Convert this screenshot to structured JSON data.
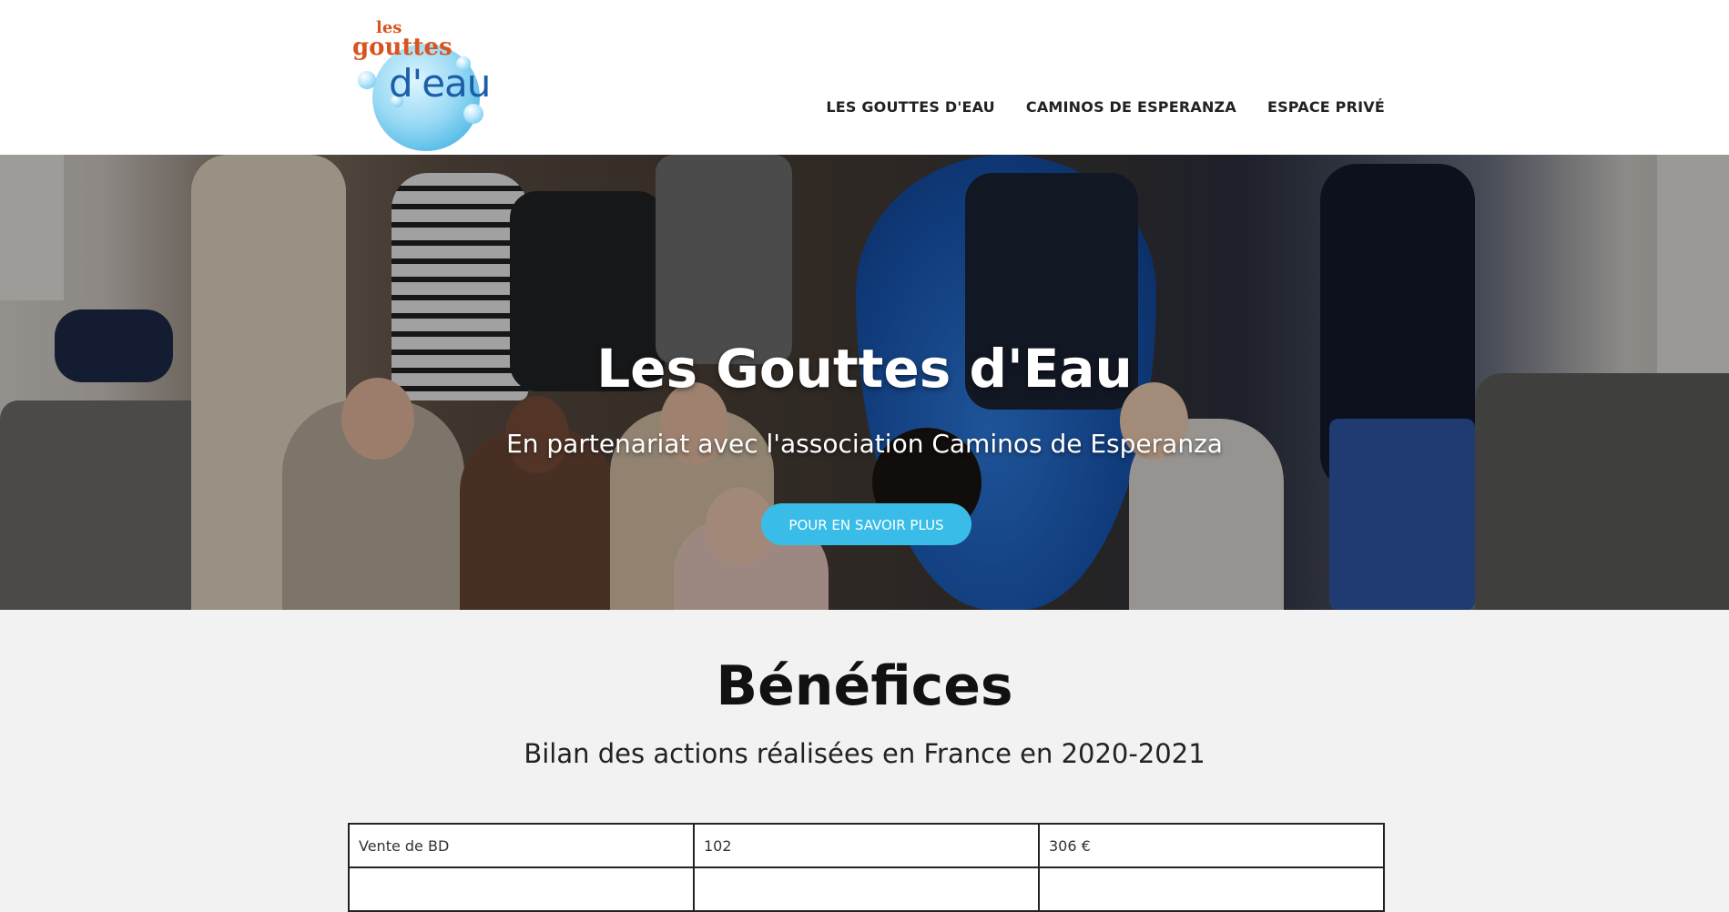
{
  "brand": {
    "logo_top": "les",
    "logo_mid": "gouttes",
    "logo_bot": "d'eau",
    "logo_colors": {
      "orange": "#d9531e",
      "blue": "#1d5ea8",
      "aqua": "#39bde8"
    }
  },
  "nav": {
    "items": [
      {
        "label": "LES GOUTTES D'EAU"
      },
      {
        "label": "CAMINOS DE ESPERANZA"
      },
      {
        "label": "ESPACE PRIVÉ"
      }
    ]
  },
  "hero": {
    "title": "Les Gouttes d'Eau",
    "subtitle": "En partenariat avec l'association Caminos de Esperanza",
    "button_label": "POUR EN SAVOIR PLUS",
    "button_color": "#39bde8"
  },
  "section": {
    "title": "Bénéfices",
    "subtitle": "Bilan des actions réalisées en France en 2020-2021"
  },
  "table": {
    "rows": [
      [
        "Vente de BD",
        "102",
        "306 €"
      ]
    ]
  }
}
